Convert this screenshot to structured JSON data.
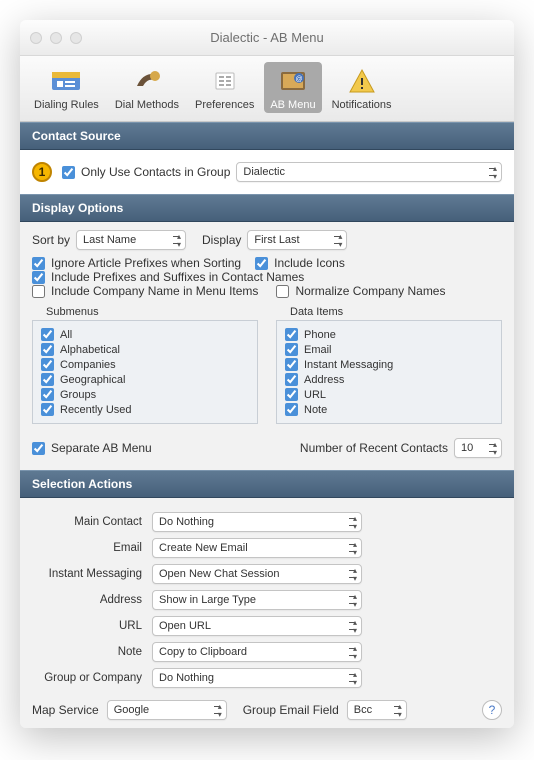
{
  "window": {
    "title": "Dialectic - AB Menu"
  },
  "toolbar": {
    "items": [
      {
        "label": "Dialing Rules"
      },
      {
        "label": "Dial Methods"
      },
      {
        "label": "Preferences"
      },
      {
        "label": "AB Menu"
      },
      {
        "label": "Notifications"
      }
    ]
  },
  "callout": "1",
  "sections": {
    "contact_source": {
      "title": "Contact Source",
      "only_use_label": "Only Use Contacts in Group",
      "group_value": "Dialectic"
    },
    "display_options": {
      "title": "Display Options",
      "sort_by_label": "Sort by",
      "sort_by_value": "Last Name",
      "display_label": "Display",
      "display_value": "First Last",
      "ignore_prefixes": "Ignore Article Prefixes when Sorting",
      "include_icons": "Include Icons",
      "include_prefixes": "Include Prefixes and Suffixes in Contact Names",
      "include_company": "Include Company Name in Menu Items",
      "normalize_names": "Normalize Company Names",
      "submenus_label": "Submenus",
      "data_items_label": "Data Items",
      "submenus": [
        "All",
        "Alphabetical",
        "Companies",
        "Geographical",
        "Groups",
        "Recently Used"
      ],
      "data_items": [
        "Phone",
        "Email",
        "Instant Messaging",
        "Address",
        "URL",
        "Note"
      ],
      "separate_menu": "Separate AB Menu",
      "recent_label": "Number of Recent Contacts",
      "recent_value": "10"
    },
    "selection_actions": {
      "title": "Selection Actions",
      "rows": [
        {
          "label": "Main Contact",
          "value": "Do Nothing"
        },
        {
          "label": "Email",
          "value": "Create New Email"
        },
        {
          "label": "Instant Messaging",
          "value": "Open New Chat Session"
        },
        {
          "label": "Address",
          "value": "Show in Large Type"
        },
        {
          "label": "URL",
          "value": "Open URL"
        },
        {
          "label": "Note",
          "value": "Copy to Clipboard"
        },
        {
          "label": "Group or Company",
          "value": "Do Nothing"
        }
      ],
      "map_service_label": "Map Service",
      "map_service_value": "Google",
      "group_email_label": "Group Email Field",
      "group_email_value": "Bcc"
    }
  }
}
